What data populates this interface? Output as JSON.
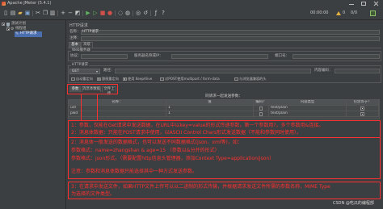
{
  "theme": {
    "background": "#3c3f41",
    "field": "#45494a",
    "text": "#bbbbbb",
    "selection": "#4b6eaf",
    "annotation": "#ff3030"
  },
  "window": {
    "title": "Apache JMeter (5.4.1)"
  },
  "toolbar": {
    "groups": [
      [
        {
          "name": "new-icon",
          "glyph": "▯",
          "color": "#d6d6d6"
        },
        {
          "name": "templates-icon",
          "glyph": "▤",
          "color": "#c8c8c8"
        },
        {
          "name": "open-icon",
          "glyph": "▰",
          "color": "#e2b550"
        },
        {
          "name": "save-icon",
          "glyph": "▣",
          "color": "#7fa8d8"
        }
      ],
      [
        {
          "name": "cut-icon",
          "glyph": "✂",
          "color": "#c8c8c8"
        },
        {
          "name": "copy-icon",
          "glyph": "❐",
          "color": "#c8c8c8"
        },
        {
          "name": "paste-icon",
          "glyph": "▥",
          "color": "#c8c8c8"
        }
      ],
      [
        {
          "name": "expand-icon",
          "glyph": "+",
          "color": "#c8c8c8"
        },
        {
          "name": "collapse-icon",
          "glyph": "−",
          "color": "#c8c8c8"
        },
        {
          "name": "toggle-icon",
          "glyph": "◩",
          "color": "#c8c8c8"
        }
      ],
      [
        {
          "name": "start-icon",
          "glyph": "▶",
          "color": "#5fb15f"
        },
        {
          "name": "start-no-pauses-icon",
          "glyph": "▷",
          "color": "#5fb15f"
        },
        {
          "name": "stop-icon",
          "glyph": "■",
          "color": "#d0504b"
        },
        {
          "name": "shutdown-icon",
          "glyph": "●",
          "color": "#d0504b"
        }
      ],
      [
        {
          "name": "clear-icon",
          "glyph": "◌",
          "color": "#c8c8c8"
        },
        {
          "name": "clear-all-icon",
          "glyph": "◍",
          "color": "#c8c8c8"
        }
      ],
      [
        {
          "name": "search-icon",
          "glyph": "◎",
          "color": "#c8c8c8"
        },
        {
          "name": "reset-search-icon",
          "glyph": "↺",
          "color": "#c8c8c8"
        }
      ],
      [
        {
          "name": "function-helper-icon",
          "glyph": "ƒ",
          "color": "#c8c8c8"
        },
        {
          "name": "help-icon",
          "glyph": "?",
          "color": "#c8c8c8"
        }
      ]
    ],
    "timer": "00:00:00",
    "warnings": "0",
    "threads": "0/0"
  },
  "tree": {
    "items": [
      {
        "label": "测试计划"
      },
      {
        "label": "线程组"
      },
      {
        "label": "HTTP请求",
        "selected": true
      }
    ]
  },
  "sampler": {
    "heading": "HTTP请求",
    "name_label": "名称：",
    "name_value": "HTTP请求",
    "comment_label": "注释：",
    "config_tabs": [
      "基本",
      "高级"
    ],
    "web_server": {
      "legend": "Web服务器",
      "protocol_label": "协议：",
      "server_label": "服务器名称或IP：",
      "port_label": "端口号："
    },
    "http_request": {
      "legend": "HTTP请求",
      "method": "GET",
      "path_label": "路径：",
      "encoding_label": "内容编码："
    },
    "options": [
      {
        "label": "自动重定向",
        "checked": false
      },
      {
        "label": "跟随重定向",
        "checked": true
      },
      {
        "label": "使用 KeepAlive",
        "checked": true
      },
      {
        "label": "对POST使用multipart / form-data",
        "checked": false
      },
      {
        "label": "与浏览器兼容的头",
        "checked": false
      }
    ],
    "body_tabs": [
      "参数",
      "消息体数据",
      "文件上传"
    ],
    "params": {
      "title": "同请求一起发送参数：",
      "columns": [
        "名称：",
        "值",
        "编码？",
        "内容类型",
        "包含等于？"
      ],
      "rows": [
        {
          "name": "uid",
          "value": "1",
          "encode": false,
          "content_type": "text/plain",
          "include_equals": true
        },
        {
          "name": "pwd",
          "value": "1",
          "encode": false,
          "content_type": "text/plain",
          "include_equals": true
        }
      ]
    }
  },
  "annotations": {
    "box1": {
      "lines": [
        "1：参数，仅能在Get请求中发送数据，在URL中以key=value的形式传递参数，第一个参数用?，多个参数用&连接。",
        "2：消息体数据：只能在POST请求中使用，以ASCII Control Chars形式发送数据（不能和参数同时使用）。"
      ],
      "detail": [
        "2：消息体一般发送的数据格式，也可以发送不同数据格式(json、xml等)，如：",
        "参数格式：name=zhangshan & age=15 （参数以&分开的形式）",
        "参数格式：json形式。（需要配置http信息头管理器，添加Context Type=application/json）",
        "注意：参数和消息体数据只能选择其中一种方式发送参数。"
      ]
    },
    "box2": {
      "lines": [
        "3：在请求中发送文件，如果HTTP文件上传可以以二进制的形式传输，并根据请求发送文件所需的参数名称，MIME Type",
        "为选择的文件类型。"
      ]
    }
  },
  "watermark": "CSDN @吃瓜的编程部"
}
